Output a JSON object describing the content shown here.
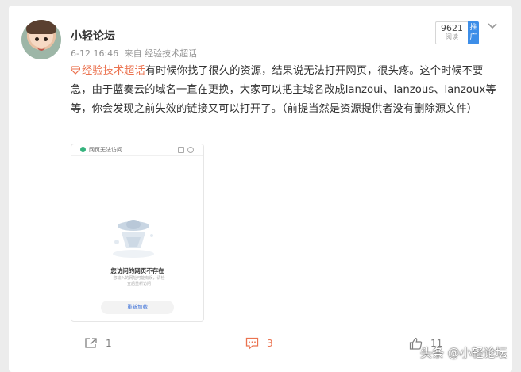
{
  "post": {
    "username": "小轻论坛",
    "timestamp": "6-12 16:46",
    "source_prefix": "来自",
    "source_name": "经验技术超话",
    "views_count": "9621",
    "views_label": "阅读",
    "promote_label": "推广",
    "topic_tag": "经验技术超话",
    "body_text": "有时候你找了很久的资源，结果说无法打开网页，很头疼。这个时候不要急，由于蓝奏云的域名一直在更换，大家可以把主域名改成lanzoui、lanzous、lanzoux等等，你会发现之前失效的链接又可以打开了。（前提当然是资源提供者没有删除源文件）"
  },
  "embedded_image": {
    "tab_title": "网页无法访问",
    "error_title": "您访问的网页不存在",
    "error_hint": "您输入的网址可能有误，请检查后重新访问",
    "reload_label": "重新加载"
  },
  "footer": {
    "forward_count": "1",
    "comment_count": "3",
    "like_count": "11"
  },
  "watermark": {
    "text": "头条 @小轻论坛"
  },
  "colors": {
    "topic": "#eb7350",
    "promote": "#3d8ee8",
    "reload_text": "#3a6fd8"
  }
}
